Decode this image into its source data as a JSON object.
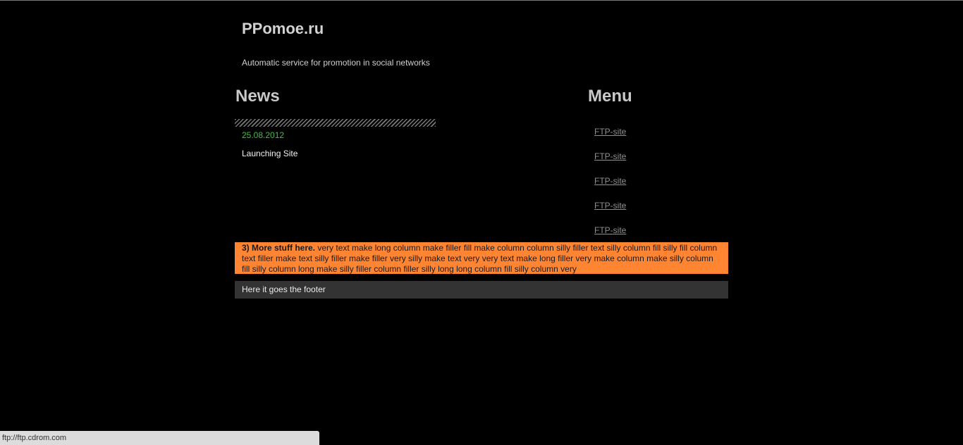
{
  "header": {
    "site_title": "PPomoe.ru",
    "tagline": "Automatic service for promotion in social networks"
  },
  "news": {
    "heading": "News",
    "items": [
      {
        "date": "25.08.2012",
        "text": "Launching Site"
      }
    ]
  },
  "menu": {
    "heading": "Menu",
    "items": [
      {
        "label": "FTP-site"
      },
      {
        "label": "FTP-site"
      },
      {
        "label": "FTP-site"
      },
      {
        "label": "FTP-site"
      },
      {
        "label": "FTP-site"
      }
    ]
  },
  "promo": {
    "bold": "3) More stuff here.",
    "text": " very text make long column make filler fill make column column silly filler text silly column fill silly fill column text filler make text silly filler make filler very silly make text very very text make long filler very make column make silly column fill silly column long make silly filler column filler silly long long column fill silly column very",
    "background": "#ff8533"
  },
  "footer": {
    "text": "Here it goes the footer"
  },
  "status_bar": {
    "url": "ftp://ftp.cdrom.com"
  },
  "colors": {
    "background": "#000000",
    "date_green": "#3fbf3f",
    "footer_bg": "#333333"
  }
}
